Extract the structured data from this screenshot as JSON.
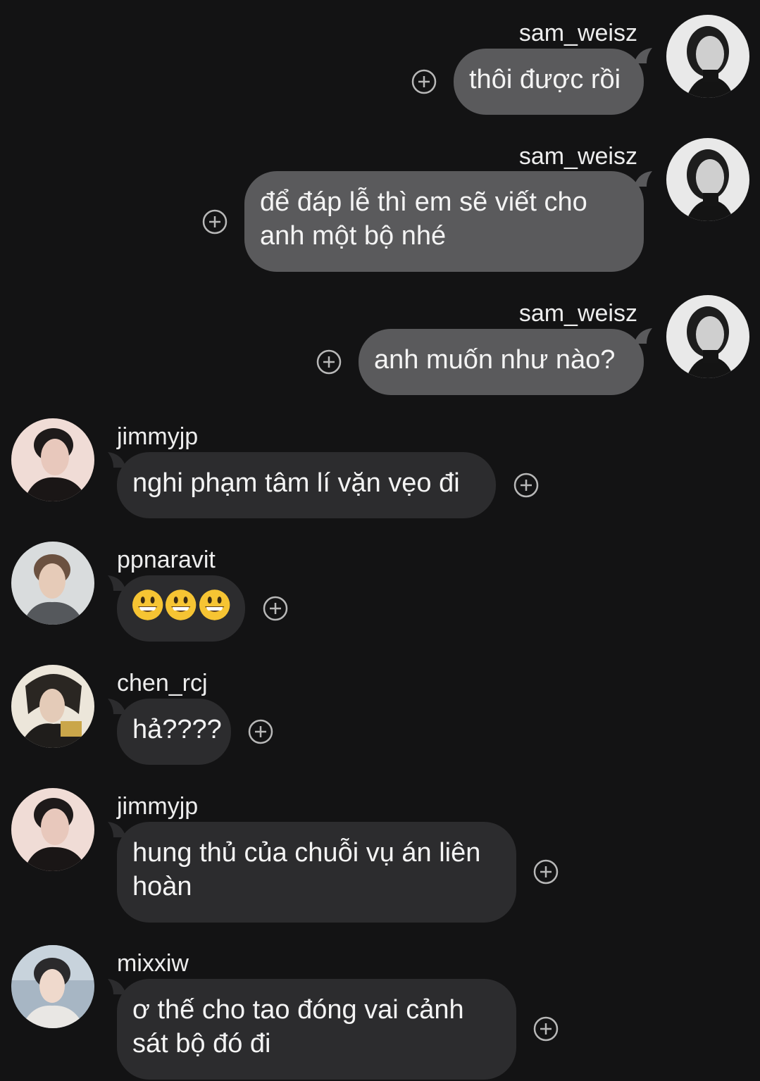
{
  "colors": {
    "background": "#131314",
    "outgoing_bubble": "#5a5a5c",
    "incoming_bubble": "#2c2c2e",
    "react_icon": "#b8b8b8"
  },
  "messages": [
    {
      "sender": "sam_weisz",
      "direction": "outgoing",
      "text": "thôi được rồi",
      "avatar": "sam-weisz-avatar"
    },
    {
      "sender": "sam_weisz",
      "direction": "outgoing",
      "text": "để đáp lễ thì em sẽ viết cho anh một bộ nhé",
      "avatar": "sam-weisz-avatar"
    },
    {
      "sender": "sam_weisz",
      "direction": "outgoing",
      "text": "anh muốn như nào?",
      "avatar": "sam-weisz-avatar"
    },
    {
      "sender": "jimmyjp",
      "direction": "incoming",
      "text": "nghi phạm tâm lí vặn vẹo đi",
      "avatar": "jimmyjp-avatar"
    },
    {
      "sender": "ppnaravit",
      "direction": "incoming",
      "text": "",
      "emojis": [
        "grinning-face",
        "grinning-face",
        "grinning-face"
      ],
      "avatar": "ppnaravit-avatar"
    },
    {
      "sender": "chen_rcj",
      "direction": "incoming",
      "text": "hả????",
      "avatar": "chen-rcj-avatar"
    },
    {
      "sender": "jimmyjp",
      "direction": "incoming",
      "text": "hung thủ của chuỗi vụ án liên hoàn",
      "avatar": "jimmyjp-avatar"
    },
    {
      "sender": "mixxiw",
      "direction": "incoming",
      "text": "ơ thế cho tao đóng vai cảnh sát bộ đó đi",
      "avatar": "mixxiw-avatar"
    }
  ],
  "icons": {
    "react": "add-reaction-icon"
  }
}
